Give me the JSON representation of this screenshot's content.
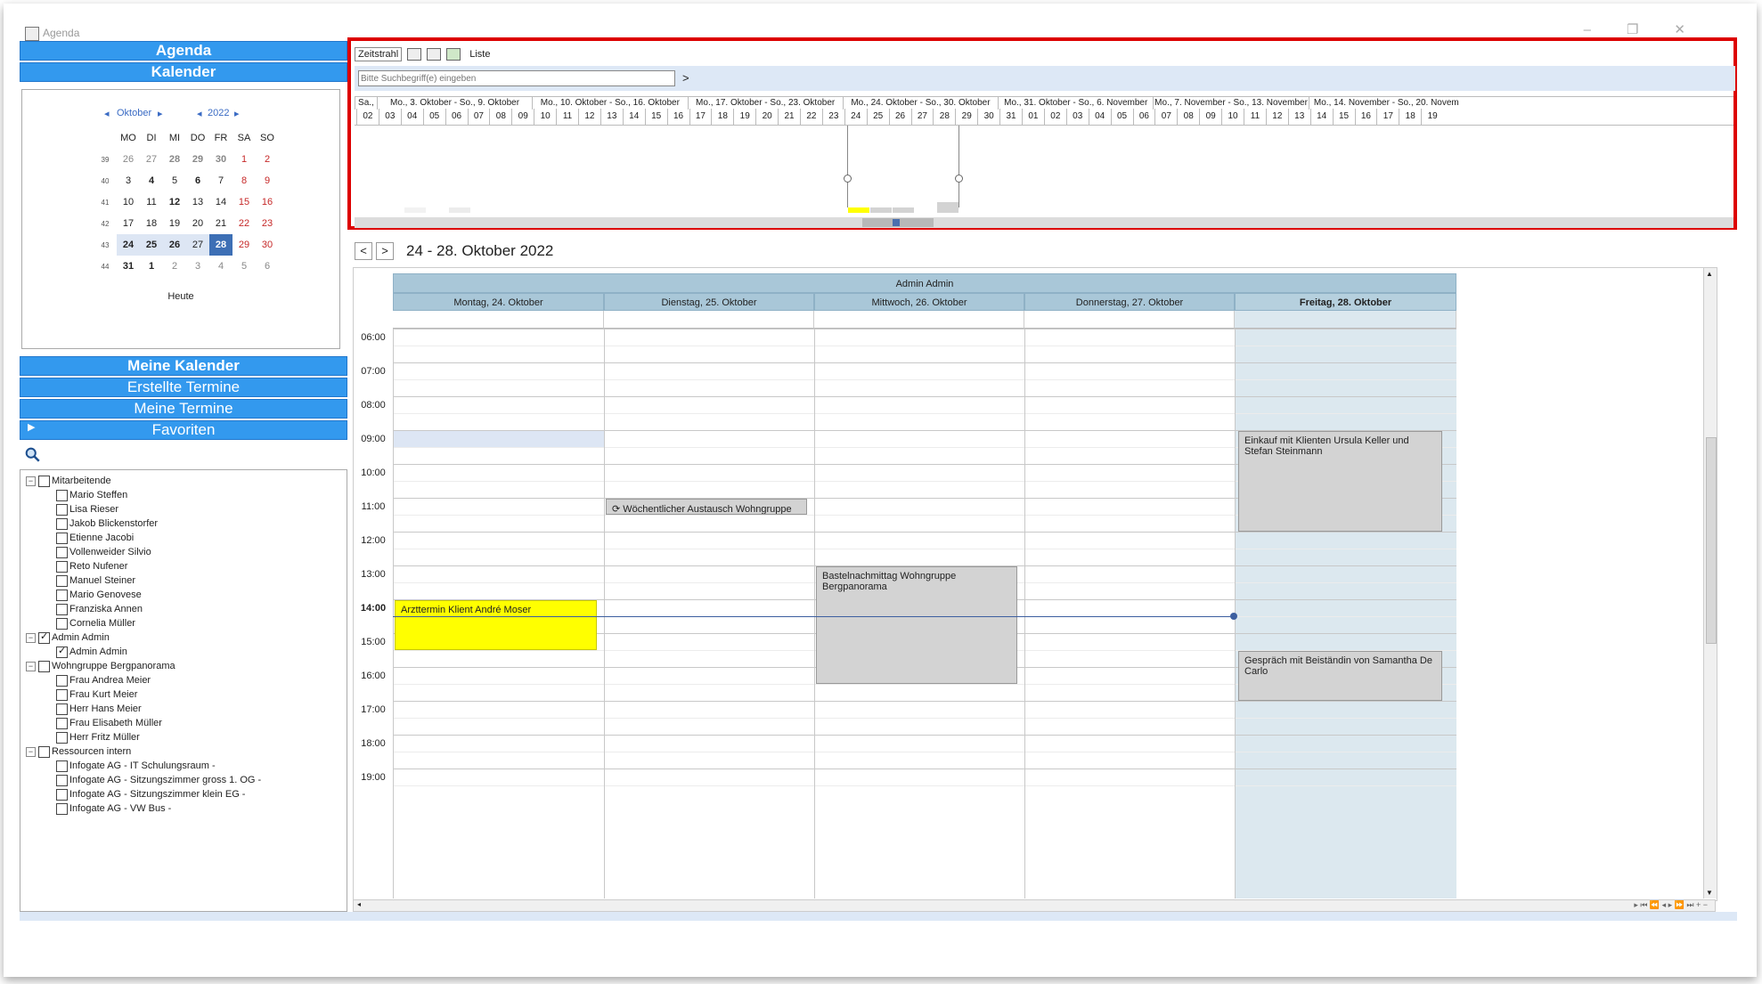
{
  "window": {
    "title": "Agenda",
    "icon": "agenda-app-icon",
    "controls": [
      "minimize-icon",
      "restore-icon",
      "close-icon"
    ]
  },
  "sidebar": {
    "agenda_label": "Agenda",
    "kalender_label": "Kalender",
    "mini_calendar": {
      "month": "Oktober",
      "year": "2022",
      "weekday_headers": [
        "MO",
        "DI",
        "MI",
        "DO",
        "FR",
        "SA",
        "SO"
      ],
      "weeks": [
        {
          "week": "39",
          "days": [
            "26",
            "27",
            "28",
            "29",
            "30",
            "1",
            "2"
          ]
        },
        {
          "week": "40",
          "days": [
            "3",
            "4",
            "5",
            "6",
            "7",
            "8",
            "9"
          ]
        },
        {
          "week": "41",
          "days": [
            "10",
            "11",
            "12",
            "13",
            "14",
            "15",
            "16"
          ]
        },
        {
          "week": "42",
          "days": [
            "17",
            "18",
            "19",
            "20",
            "21",
            "22",
            "23"
          ]
        },
        {
          "week": "43",
          "days": [
            "24",
            "25",
            "26",
            "27",
            "28",
            "29",
            "30"
          ]
        },
        {
          "week": "44",
          "days": [
            "31",
            "1",
            "2",
            "3",
            "4",
            "5",
            "6"
          ]
        }
      ],
      "today_label": "Heute",
      "selected_day": "28"
    },
    "meine_kalender_label": "Meine Kalender",
    "erstellte_termine_label": "Erstellte Termine",
    "meine_termine_label": "Meine Termine",
    "favoriten_label": "Favoriten",
    "tree": [
      {
        "label": "Mitarbeitende",
        "level": 0,
        "checked": false
      },
      {
        "label": "Mario Steffen",
        "level": 1,
        "checked": false
      },
      {
        "label": "Lisa Rieser",
        "level": 1,
        "checked": false
      },
      {
        "label": "Jakob Blickenstorfer",
        "level": 1,
        "checked": false
      },
      {
        "label": "Etienne Jacobi",
        "level": 1,
        "checked": false
      },
      {
        "label": "Vollenweider Silvio",
        "level": 1,
        "checked": false
      },
      {
        "label": "Reto Nufener",
        "level": 1,
        "checked": false
      },
      {
        "label": "Manuel Steiner",
        "level": 1,
        "checked": false
      },
      {
        "label": "Mario Genovese",
        "level": 1,
        "checked": false
      },
      {
        "label": "Franziska Annen",
        "level": 1,
        "checked": false
      },
      {
        "label": "Cornelia Müller",
        "level": 1,
        "checked": false
      },
      {
        "label": "Admin Admin",
        "level": 0,
        "checked": true
      },
      {
        "label": "Admin Admin",
        "level": 1,
        "checked": true
      },
      {
        "label": "Wohngruppe Bergpanorama",
        "level": 0,
        "checked": false
      },
      {
        "label": "Frau Andrea Meier",
        "level": 1,
        "checked": false
      },
      {
        "label": "Frau Kurt Meier",
        "level": 1,
        "checked": false
      },
      {
        "label": "Herr Hans Meier",
        "level": 1,
        "checked": false
      },
      {
        "label": "Frau Elisabeth Müller",
        "level": 1,
        "checked": false
      },
      {
        "label": "Herr Fritz Müller",
        "level": 1,
        "checked": false
      },
      {
        "label": "Ressourcen intern",
        "level": 0,
        "checked": false
      },
      {
        "label": "Infogate AG - IT Schulungsraum -",
        "level": 1,
        "checked": false
      },
      {
        "label": "Infogate AG - Sitzungszimmer gross 1. OG -",
        "level": 1,
        "checked": false
      },
      {
        "label": "Infogate AG - Sitzungszimmer klein EG -",
        "level": 1,
        "checked": false
      },
      {
        "label": "Infogate AG - VW Bus -",
        "level": 1,
        "checked": false
      }
    ]
  },
  "toolbar": {
    "zeitstrahl_label": "Zeitstrahl",
    "liste_label": "Liste",
    "icons": [
      "print-icon",
      "camera-icon",
      "export-icon"
    ],
    "search_placeholder": "Bitte Suchbegriff(e) eingeben",
    "search_go": ">"
  },
  "timeline": {
    "weeks": [
      "Sa., ...",
      "Mo., 3. Oktober - So., 9. Oktober",
      "Mo., 10. Oktober - So., 16. Oktober",
      "Mo., 17. Oktober - So., 23. Oktober",
      "Mo., 24. Oktober - So., 30. Oktober",
      "Mo., 31. Oktober - So., 6. November",
      "Mo., 7. November - So., 13. November",
      "Mo., 14. November - So., 20. Novem"
    ],
    "days": [
      "02",
      "03",
      "04",
      "05",
      "06",
      "07",
      "08",
      "09",
      "10",
      "11",
      "12",
      "13",
      "14",
      "15",
      "16",
      "17",
      "18",
      "19",
      "20",
      "21",
      "22",
      "23",
      "24",
      "25",
      "26",
      "27",
      "28",
      "29",
      "30",
      "31",
      "01",
      "02",
      "03",
      "04",
      "05",
      "06",
      "07",
      "08",
      "09",
      "10",
      "11",
      "12",
      "13",
      "14",
      "15",
      "16",
      "17",
      "18",
      "19"
    ]
  },
  "calendar": {
    "prev": "<",
    "next": ">",
    "date_range": "24 - 28. Oktober 2022",
    "resource": "Admin Admin",
    "days": [
      "Montag, 24. Oktober",
      "Dienstag, 25. Oktober",
      "Mittwoch, 26. Oktober",
      "Donnerstag, 27. Oktober",
      "Freitag, 28. Oktober"
    ],
    "hours": [
      "06:00",
      "07:00",
      "08:00",
      "09:00",
      "10:00",
      "11:00",
      "12:00",
      "13:00",
      "14:00",
      "15:00",
      "16:00",
      "17:00",
      "18:00",
      "19:00"
    ],
    "current_hour": "14:00",
    "events": [
      {
        "title": "Arzttermin Klient André Moser",
        "day": 0,
        "start": "14:00",
        "end": "15:30",
        "color": "#ffff00"
      },
      {
        "title": "Wöchentlicher Austausch Wohngruppe Seeblick",
        "day": 1,
        "start": "11:00",
        "end": "11:30",
        "color": "#d3d3d3",
        "recurring": true
      },
      {
        "title": "Bastelnachmittag Wohngruppe Bergpanorama",
        "day": 2,
        "start": "13:00",
        "end": "16:30",
        "color": "#d3d3d3"
      },
      {
        "title": "Einkauf mit Klienten Ursula Keller und Stefan Steinmann",
        "day": 4,
        "start": "09:00",
        "end": "12:00",
        "color": "#d3d3d3"
      },
      {
        "title": "Gespräch mit Beiständin von Samantha De Carlo",
        "day": 4,
        "start": "15:30",
        "end": "17:00",
        "color": "#d3d3d3"
      }
    ]
  },
  "colors": {
    "sidebar_blue": "#3399ee",
    "highlight_red": "#dd0000",
    "header_blue": "#a9c7d8",
    "event_yellow": "#ffff00",
    "event_gray": "#d3d3d3"
  }
}
